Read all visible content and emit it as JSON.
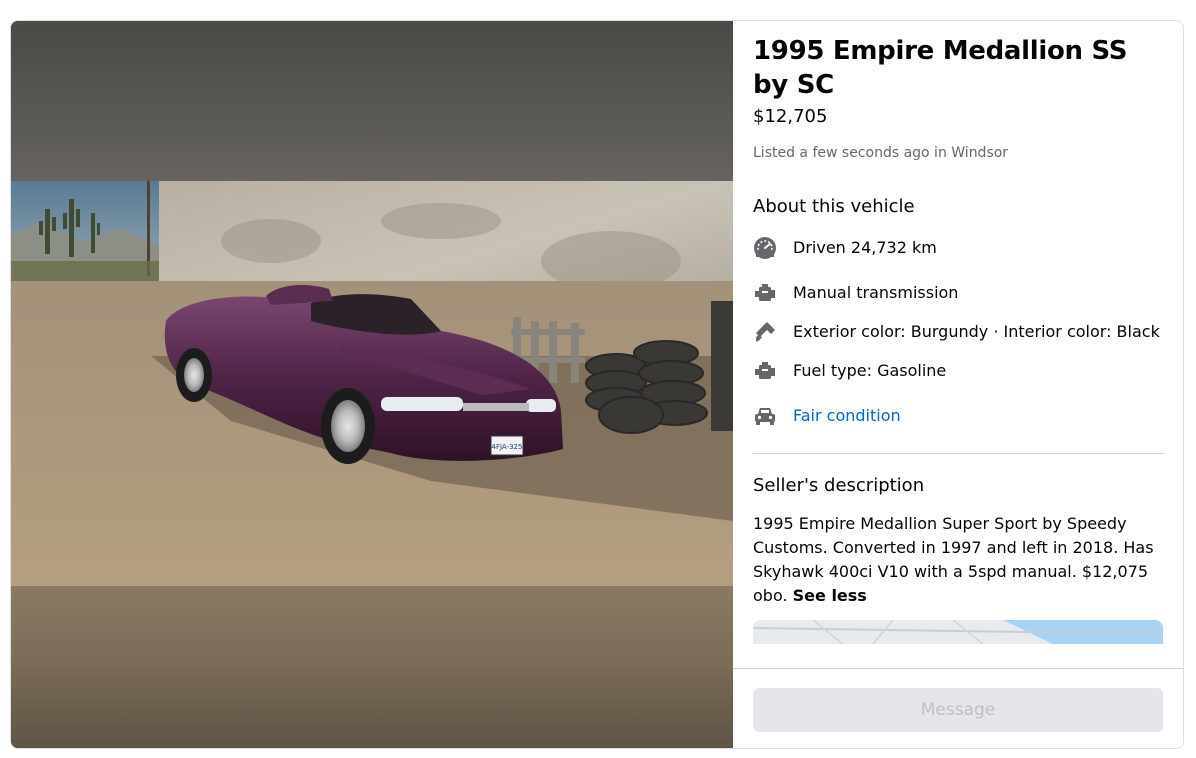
{
  "listing": {
    "title": "1995 Empire Medallion SS by SC",
    "price": "$12,705",
    "listed": "Listed a few seconds ago in Windsor"
  },
  "about": {
    "heading": "About this vehicle",
    "items": [
      {
        "icon": "speedometer-icon",
        "text": "Driven 24,732 km"
      },
      {
        "icon": "engine-icon",
        "text": "Manual transmission"
      },
      {
        "icon": "paint-brush-icon",
        "text": "Exterior color: Burgundy · Interior color: Black"
      },
      {
        "icon": "engine-icon",
        "text": "Fuel type: Gasoline"
      },
      {
        "icon": "car-icon",
        "text": "Fair condition"
      }
    ]
  },
  "description": {
    "heading": "Seller's description",
    "text": "1995 Empire Medallion Super Sport by Speedy Customs. Converted in 1997 and left in 2018. Has Skyhawk 400ci V10 with a 5spd manual. $12,075 obo.",
    "see_less": "See less"
  },
  "footer": {
    "message_label": "Message"
  },
  "photo": {
    "plate": "4FJA-325"
  },
  "colors": {
    "link": "#0064d1",
    "secondary_text": "#65676b",
    "button_disabled_bg": "#e4e6eb",
    "car_body": "#4a1f3e"
  }
}
